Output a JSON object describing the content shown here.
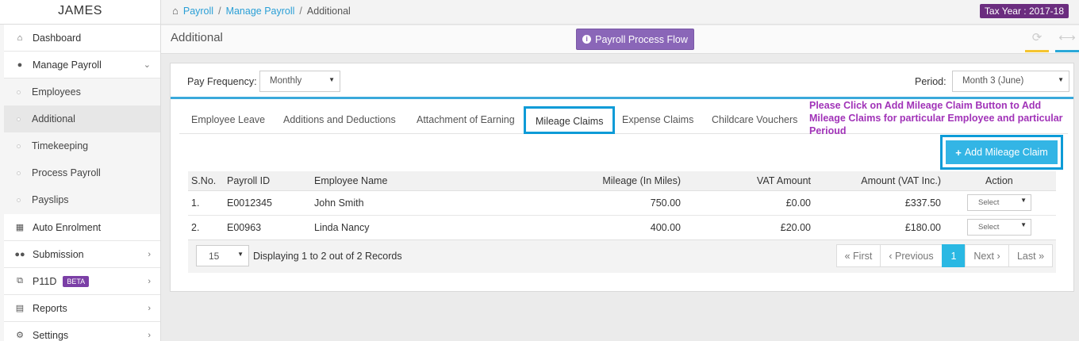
{
  "sidebar": {
    "brand": "JAMES",
    "items": [
      {
        "label": "Dashboard",
        "icon": "home-icon"
      },
      {
        "label": "Manage Payroll",
        "icon": "user-icon"
      },
      {
        "label": "Auto Enrolment",
        "icon": "grid-icon"
      },
      {
        "label": "Submission",
        "icon": "users-icon"
      },
      {
        "label": "P11D",
        "icon": "copy-icon",
        "badge": "BETA"
      },
      {
        "label": "Reports",
        "icon": "report-icon"
      },
      {
        "label": "Settings",
        "icon": "gear-icon"
      }
    ],
    "subitems": [
      "Employees",
      "Additional",
      "Timekeeping",
      "Process Payroll",
      "Payslips"
    ]
  },
  "breadcrumb": {
    "items": [
      "Payroll",
      "Manage Payroll",
      "Additional"
    ]
  },
  "tax_year": "Tax Year : 2017-18",
  "page": {
    "title": "Additional",
    "flow_button": "Payroll Process Flow"
  },
  "filters": {
    "pay_frequency_label": "Pay Frequency:",
    "pay_frequency_value": "Monthly",
    "period_label": "Period:",
    "period_value": "Month 3 (June)"
  },
  "tabs": [
    "Employee Leave",
    "Additions and Deductions",
    "Attachment of Earning",
    "Mileage Claims",
    "Expense Claims",
    "Childcare Vouchers"
  ],
  "active_tab": "Mileage Claims",
  "hint": "Please Click on Add Mileage Claim Button to Add Mileage Claims for particular Employee and particular Perioud",
  "add_button": "Add Mileage Claim",
  "table": {
    "columns": [
      "S.No.",
      "Payroll ID",
      "Employee Name",
      "Mileage (In Miles)",
      "VAT Amount",
      "Amount (VAT Inc.)",
      "Action"
    ],
    "rows": [
      {
        "sno": "1.",
        "payroll_id": "E0012345",
        "name": "John Smith",
        "mileage": "750.00",
        "vat": "£0.00",
        "amount": "£337.50",
        "action": "Select"
      },
      {
        "sno": "2.",
        "payroll_id": "E00963",
        "name": "Linda Nancy",
        "mileage": "400.00",
        "vat": "£20.00",
        "amount": "£180.00",
        "action": "Select"
      }
    ]
  },
  "pagination": {
    "page_size": "15",
    "display_text": "Displaying 1 to 2 out of 2 Records",
    "first": "« First",
    "previous": "‹ Previous",
    "current": "1",
    "next": "Next ›",
    "last": "Last »"
  },
  "colors": {
    "accent": "#2ab8e3",
    "purple": "#8a66b8",
    "hint": "#a133b8",
    "tax_badge": "#6b2d7f"
  }
}
